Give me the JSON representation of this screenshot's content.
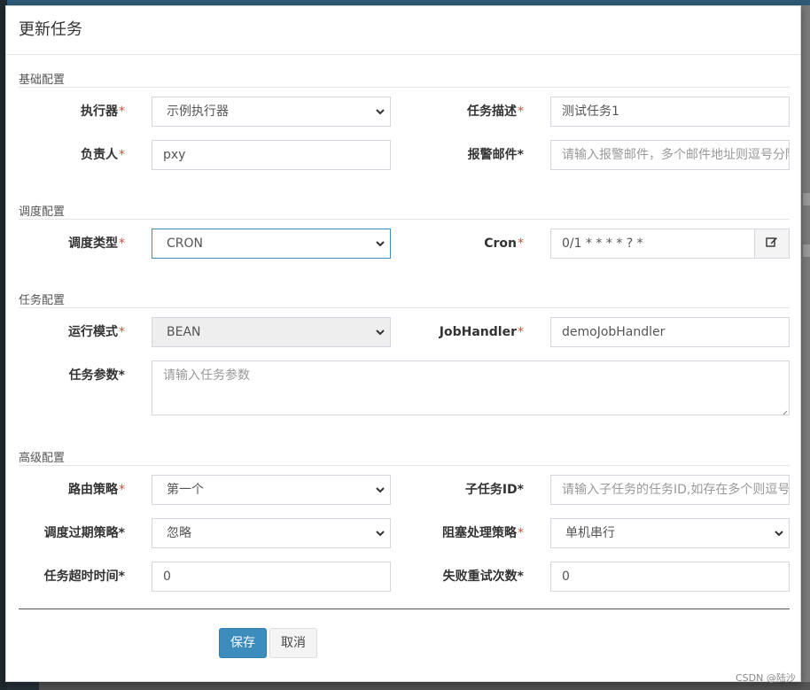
{
  "modal": {
    "title": "更新任务"
  },
  "sections": {
    "basic": "基础配置",
    "schedule": "调度配置",
    "task": "任务配置",
    "advanced": "高级配置"
  },
  "fields": {
    "executor": {
      "label": "执行器",
      "value": "示例执行器"
    },
    "job_desc": {
      "label": "任务描述",
      "value": "测试任务1"
    },
    "author": {
      "label": "负责人",
      "value": "pxy"
    },
    "alarm_email": {
      "label": "报警邮件",
      "placeholder": "请输入报警邮件，多个邮件地址则逗号分隔"
    },
    "schedule_type": {
      "label": "调度类型",
      "value": "CRON"
    },
    "cron": {
      "label": "Cron",
      "value": "0/1 * * * * ? *"
    },
    "glue_type": {
      "label": "运行模式",
      "value": "BEAN"
    },
    "job_handler": {
      "label": "JobHandler",
      "value": "demoJobHandler"
    },
    "job_param": {
      "label": "任务参数",
      "placeholder": "请输入任务参数"
    },
    "route_strategy": {
      "label": "路由策略",
      "value": "第一个"
    },
    "child_job_id": {
      "label": "子任务ID",
      "placeholder": "请输入子任务的任务ID,如存在多个则逗号分隔"
    },
    "misfire_strategy": {
      "label": "调度过期策略",
      "value": "忽略"
    },
    "block_strategy": {
      "label": "阻塞处理策略",
      "value": "单机串行"
    },
    "timeout": {
      "label": "任务超时时间",
      "value": "0"
    },
    "fail_retry": {
      "label": "失败重试次数",
      "value": "0"
    }
  },
  "required_mark": "*",
  "buttons": {
    "save": "保存",
    "cancel": "取消"
  },
  "watermark": "CSDN @陆沙",
  "colors": {
    "primary": "#3c8dbc",
    "required": "#dd4b39",
    "border": "#d2d6de"
  },
  "icons": {
    "cron_edit": "edit-icon",
    "select_caret": "chevron-down-icon"
  }
}
